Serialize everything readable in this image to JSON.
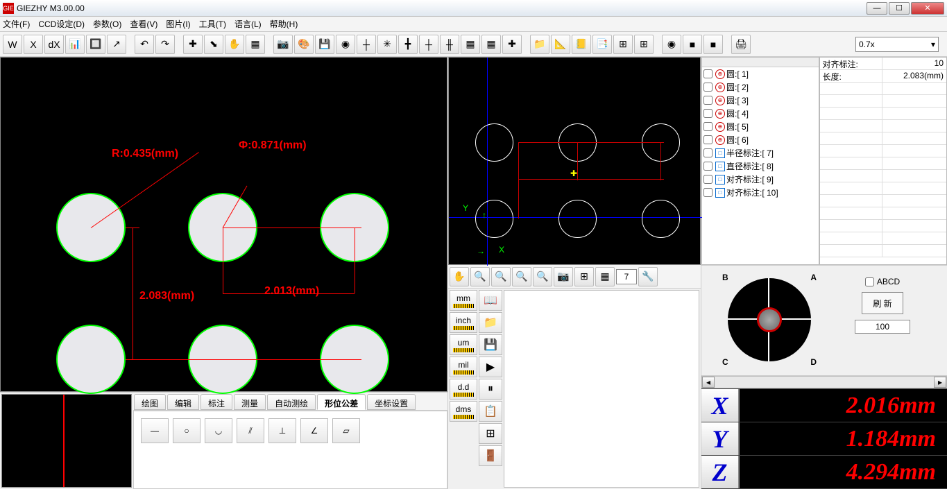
{
  "title": "GIEZHY M3.00.00",
  "menu": [
    "文件(F)",
    "CCD设定(D)",
    "参数(O)",
    "查看(V)",
    "图片(I)",
    "工具(T)",
    "语言(L)",
    "帮助(H)"
  ],
  "toolbar": [
    "W",
    "X",
    "dX",
    "📊",
    "🔲",
    "↗",
    "",
    "↶",
    "↷",
    "",
    "✚",
    "⬊",
    "✋",
    "▦",
    "",
    "📷",
    "🎨",
    "💾",
    "◉",
    "┼",
    "✳",
    "╋",
    "┼",
    "╫",
    "▦",
    "▦",
    "✚",
    "",
    "📁",
    "📐",
    "📒",
    "📑",
    "⊞",
    "⊞",
    "",
    "◉",
    "■",
    "■",
    "",
    "🖨"
  ],
  "zoom": "0.7x",
  "camera": {
    "r_label": "R:0.435(mm)",
    "phi_label": "Φ:0.871(mm)",
    "h_label": "2.083(mm)",
    "w_label": "2.013(mm)"
  },
  "tabs": [
    "绘图",
    "编辑",
    "标注",
    "测量",
    "自动测绘",
    "形位公差",
    "坐标设置"
  ],
  "active_tab": 5,
  "shapes": [
    "—",
    "○",
    "◡",
    "⫽",
    "⊥",
    "∠",
    "▱"
  ],
  "midtools": [
    "✋",
    "🔍",
    "🔍",
    "🔍",
    "🔍",
    "📷",
    "⊞",
    "▦"
  ],
  "midinput": "7",
  "units": [
    "mm",
    "inch",
    "um",
    "mil",
    "d.d",
    "dms"
  ],
  "ctrls": [
    "📖",
    "📁",
    "💾",
    "▶",
    "⏸",
    "📋",
    "⊞",
    "🚪"
  ],
  "features": [
    {
      "type": "circle",
      "label": "圆:[ 1]"
    },
    {
      "type": "circle",
      "label": "圆:[ 2]"
    },
    {
      "type": "circle",
      "label": "圆:[ 3]"
    },
    {
      "type": "circle",
      "label": "圆:[ 4]"
    },
    {
      "type": "circle",
      "label": "圆:[ 5]"
    },
    {
      "type": "circle",
      "label": "圆:[ 6]"
    },
    {
      "type": "dim",
      "label": "半径标注:[ 7]"
    },
    {
      "type": "dim",
      "label": "直径标注:[ 8]"
    },
    {
      "type": "dim",
      "label": "对齐标注:[ 9]"
    },
    {
      "type": "dim",
      "label": "对齐标注:[ 10]"
    }
  ],
  "props": [
    {
      "k": "对齐标注:",
      "v": "10"
    },
    {
      "k": "长度:",
      "v": "2.083(mm)"
    }
  ],
  "joystick": {
    "corners": [
      "B",
      "A",
      "C",
      "D"
    ],
    "abcd": "ABCD",
    "refresh": "刷 新",
    "val": "100"
  },
  "coords": [
    {
      "axis": "X",
      "val": "2.016mm"
    },
    {
      "axis": "Y",
      "val": "1.184mm"
    },
    {
      "axis": "Z",
      "val": "4.294mm"
    }
  ],
  "cad": {
    "x": "X",
    "y": "Y"
  }
}
